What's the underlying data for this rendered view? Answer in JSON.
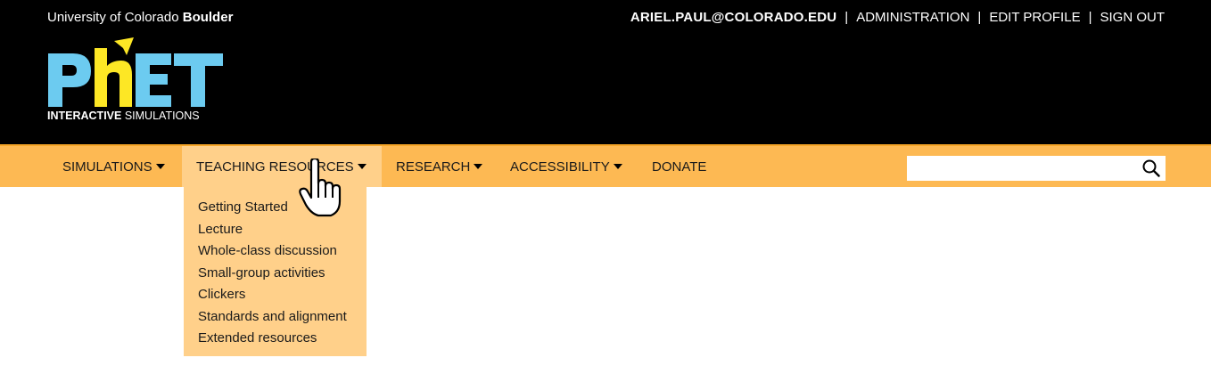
{
  "header": {
    "university_prefix": "University of Colorado",
    "university_bold": "Boulder",
    "user_email": "ARIEL.PAUL@COLORADO.EDU",
    "links": [
      "ADMINISTRATION",
      "EDIT PROFILE",
      "SIGN OUT"
    ],
    "logo": {
      "wordmark": "PhET",
      "tagline_bold": "INTERACTIVE",
      "tagline_regular": "SIMULATIONS"
    }
  },
  "nav": {
    "items": [
      {
        "label": "SIMULATIONS",
        "has_caret": true
      },
      {
        "label": "TEACHING RESOURCES",
        "has_caret": true,
        "active": true
      },
      {
        "label": "RESEARCH",
        "has_caret": true
      },
      {
        "label": "ACCESSIBILITY",
        "has_caret": true
      },
      {
        "label": "DONATE",
        "has_caret": false
      }
    ],
    "search_placeholder": ""
  },
  "dropdown": {
    "items": [
      "Getting Started",
      "Lecture",
      "Whole-class discussion",
      "Small-group activities",
      "Clickers",
      "Standards and alignment",
      "Extended resources"
    ]
  },
  "colors": {
    "header_bg": "#000000",
    "nav_bg": "#fdb953",
    "nav_active_bg": "#ffd08a",
    "logo_blue": "#6ccbf0",
    "logo_yellow": "#fde725"
  }
}
